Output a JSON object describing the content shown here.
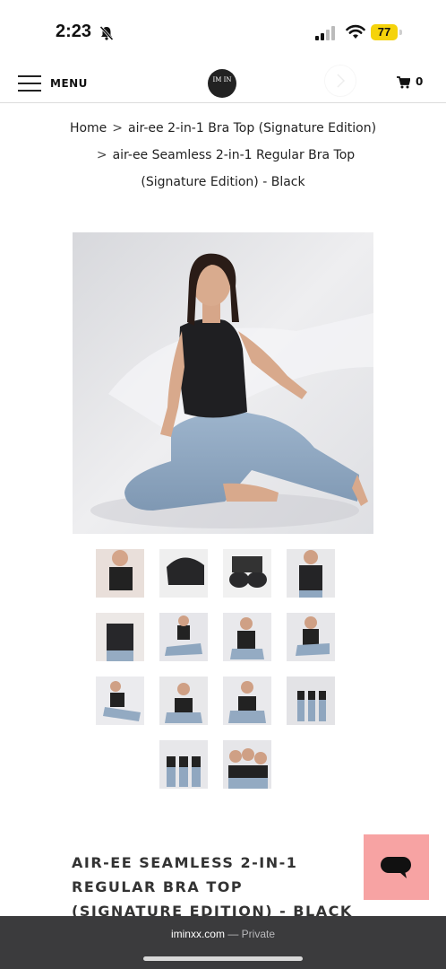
{
  "status_bar": {
    "time": "2:23",
    "battery": "77",
    "icons": [
      "bell-slash-icon",
      "signal-icon",
      "wifi-icon",
      "battery-icon"
    ]
  },
  "header": {
    "menu_label": "MENU",
    "logo_text": "IM IN",
    "cart_count": "0",
    "icons": [
      "hamburger-icon",
      "logo-icon",
      "arrow-circle-icon",
      "cart-icon"
    ]
  },
  "breadcrumb": {
    "home": "Home",
    "separator": ">",
    "category": "air-ee 2-in-1 Bra Top (Signature Edition)",
    "product_line1": "air-ee Seamless 2-in-1 Regular Bra Top",
    "product_line2": "(Signature Edition) - Black"
  },
  "gallery": {
    "main_image": "model-seated-black-bra-top-jeans",
    "thumbnails": [
      "closeup-front",
      "bra-cup-detail",
      "bra-flat",
      "front-model",
      "back-view",
      "seated-full",
      "seated-half",
      "seated-side",
      "reclining",
      "arms-up",
      "seated-pose",
      "group-three",
      "group-three-seated",
      "group-trio-closeup"
    ]
  },
  "product": {
    "title": "AIR-EE SEAMLESS 2-IN-1 REGULAR BRA TOP (SIGNATURE EDITION) - BLACK"
  },
  "chat": {
    "icon": "chat-bubble-icon",
    "color": "#f7a3a3"
  },
  "url_bar": {
    "domain": "iminxx.com",
    "separator": " — ",
    "mode": "Private"
  }
}
